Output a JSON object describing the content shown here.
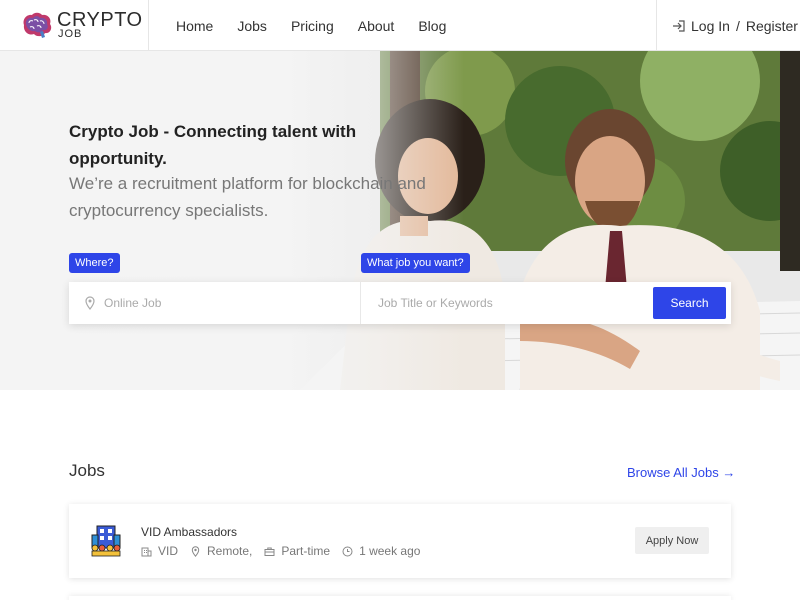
{
  "logo": {
    "line1": "CRYPTO",
    "line2": "JOB"
  },
  "nav": {
    "items": [
      "Home",
      "Jobs",
      "Pricing",
      "About",
      "Blog"
    ]
  },
  "auth": {
    "login": "Log In",
    "separator": "/",
    "register": "Register"
  },
  "hero": {
    "title": "Crypto Job - Connecting talent with opportunity.",
    "subtitle": "We’re a recruitment platform for blockchain and cryptocurrency specialists.",
    "where_tag": "Where?",
    "what_tag": "What job you want?",
    "location_placeholder": "Online Job",
    "keyword_placeholder": "Job Title or Keywords",
    "search_label": "Search"
  },
  "jobs": {
    "heading": "Jobs",
    "browse_all": "Browse All Jobs →",
    "items": [
      {
        "title": "VID Ambassadors",
        "company": "VID",
        "location": "Remote,",
        "type": "Part-time",
        "posted": "1 week ago",
        "apply_label": "Apply Now"
      }
    ]
  },
  "colors": {
    "accent": "#2e45e8",
    "text": "#333333",
    "muted": "#777777"
  },
  "icons": [
    "brain-logo-icon",
    "login-icon",
    "location-pin-icon",
    "building-icon",
    "briefcase-icon",
    "clock-icon",
    "company-logo-icon"
  ]
}
